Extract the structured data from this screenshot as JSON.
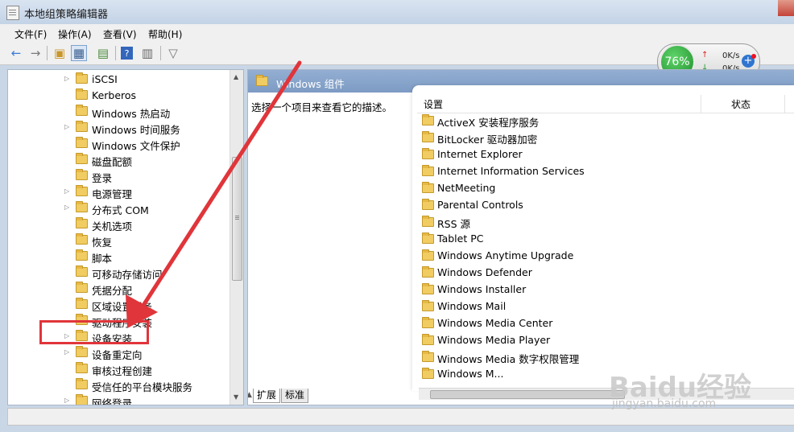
{
  "window": {
    "title": "本地组策略编辑器"
  },
  "menu": [
    "文件(F)",
    "操作(A)",
    "查看(V)",
    "帮助(H)"
  ],
  "toolbar_icons": [
    "back-arrow-icon",
    "forward-arrow-icon",
    "up-folder-icon",
    "show-tree-icon",
    "export-list-icon",
    "help-icon",
    "properties-icon",
    "filter-icon"
  ],
  "netwidget": {
    "percent": "76%",
    "up": "0K/s",
    "down": "0K/s"
  },
  "tree": [
    {
      "label": "iSCSI",
      "expandable": true
    },
    {
      "label": "Kerberos",
      "expandable": false
    },
    {
      "label": "Windows 热启动",
      "expandable": false
    },
    {
      "label": "Windows 时间服务",
      "expandable": true
    },
    {
      "label": "Windows 文件保护",
      "expandable": false
    },
    {
      "label": "磁盘配额",
      "expandable": false
    },
    {
      "label": "登录",
      "expandable": false
    },
    {
      "label": "电源管理",
      "expandable": true
    },
    {
      "label": "分布式 COM",
      "expandable": true
    },
    {
      "label": "关机选项",
      "expandable": false
    },
    {
      "label": "恢复",
      "expandable": false
    },
    {
      "label": "脚本",
      "expandable": false
    },
    {
      "label": "可移动存储访问",
      "expandable": false
    },
    {
      "label": "凭据分配",
      "expandable": false
    },
    {
      "label": "区域设置服务",
      "expandable": false
    },
    {
      "label": "驱动程序安装",
      "expandable": false
    },
    {
      "label": "设备安装",
      "expandable": true
    },
    {
      "label": "设备重定向",
      "expandable": true
    },
    {
      "label": "审核过程创建",
      "expandable": false
    },
    {
      "label": "受信任的平台模块服务",
      "expandable": false
    },
    {
      "label": "网络登录",
      "expandable": true
    }
  ],
  "right": {
    "header_title": "Windows 组件",
    "description": "选择一个项目来查看它的描述。",
    "col_setting": "设置",
    "col_state": "状态",
    "items": [
      "ActiveX 安装程序服务",
      "BitLocker 驱动器加密",
      "Internet Explorer",
      "Internet Information Services",
      "NetMeeting",
      "Parental Controls",
      "RSS 源",
      "Tablet PC",
      "Windows Anytime Upgrade",
      "Windows Defender",
      "Windows Installer",
      "Windows Mail",
      "Windows Media Center",
      "Windows Media Player",
      "Windows Media 数字权限管理",
      "Windows M..."
    ],
    "tab_extended": "扩展",
    "tab_standard": "标准"
  },
  "watermark": {
    "brand": "Baidu经验",
    "url": "jingyan.baidu.com"
  },
  "colors": {
    "annotation": "#e0353a",
    "header": "#8aa6cc",
    "folder": "#f0cc62"
  }
}
